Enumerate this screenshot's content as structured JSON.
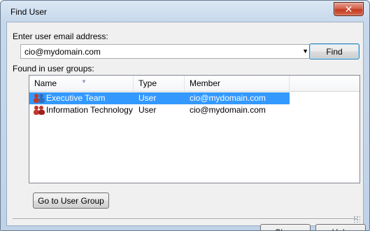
{
  "window": {
    "title": "Find User",
    "close_glyph": "✕"
  },
  "email": {
    "label": "Enter user email address:",
    "value": "cio@mydomain.com",
    "dropdown_icon": "chevron-down-icon"
  },
  "buttons": {
    "find": "Find",
    "go_to_group": "Go to User Group",
    "close": "Close",
    "help": "Help"
  },
  "groups": {
    "label": "Found in user groups:",
    "columns": [
      "Name",
      "Type",
      "Member"
    ],
    "rows": [
      {
        "name": "Executive Team",
        "type": "User",
        "member": "cio@mydomain.com",
        "selected": true,
        "icon": "user-group-icon"
      },
      {
        "name": "Information Technology",
        "type": "User",
        "member": "cio@mydomain.com",
        "selected": false,
        "icon": "user-group-icon"
      }
    ]
  },
  "colors": {
    "selection": "#3399ff",
    "titlebar": "#c7d8ec",
    "close_button": "#c43b21"
  }
}
